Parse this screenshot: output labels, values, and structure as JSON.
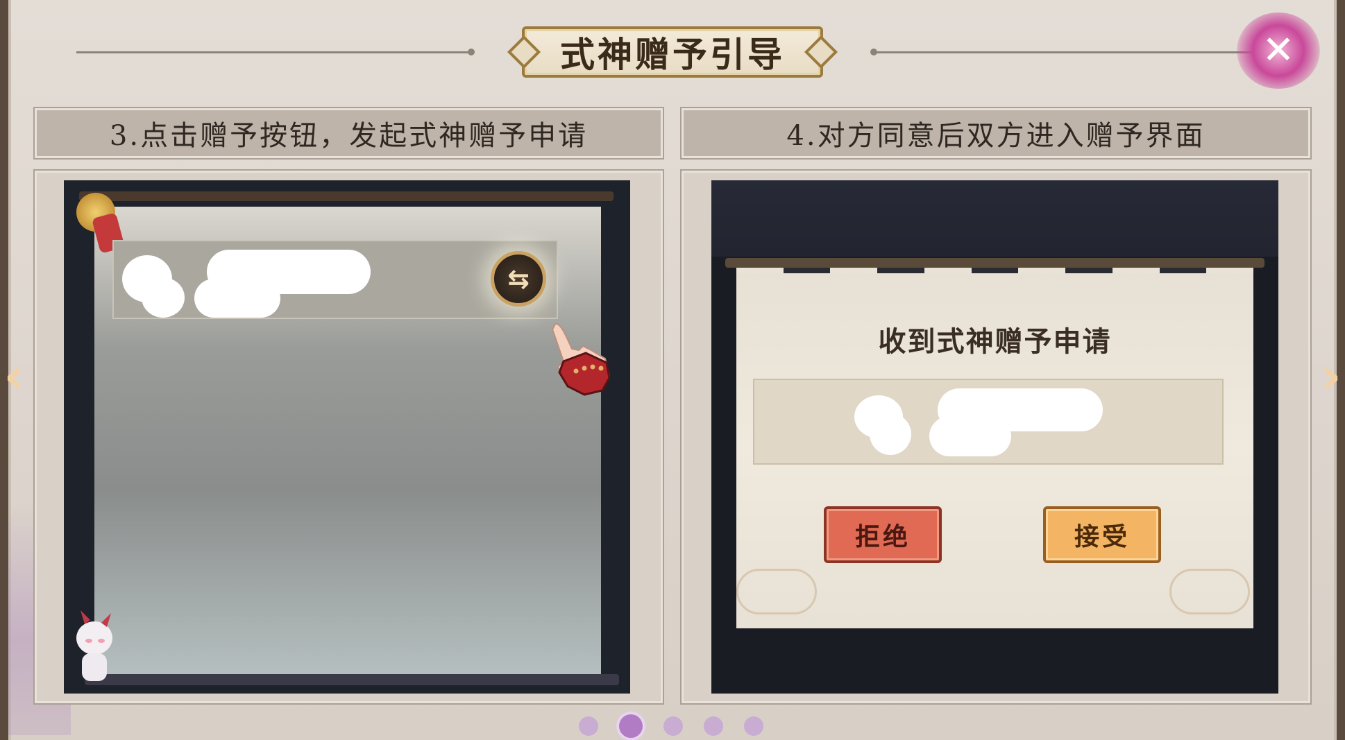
{
  "title": "式神赠予引导",
  "steps": [
    {
      "header": "3.点击赠予按钮，发起式神赠予申请"
    },
    {
      "header": "4.对方同意后双方进入赠予界面"
    }
  ],
  "right_screen": {
    "dialog_title": "收到式神赠予申请",
    "reject_label": "拒绝",
    "accept_label": "接受"
  },
  "icons": {
    "close": "close-icon",
    "swap": "swap-arrows-icon",
    "prev": "chevron-left-icon",
    "next": "chevron-right-icon"
  },
  "pagination": {
    "total": 5,
    "current": 2
  },
  "colors": {
    "accent_close": "#c9489a",
    "reject": "#e06a53",
    "accept": "#f3b463",
    "pager_active": "#b17cc4"
  }
}
